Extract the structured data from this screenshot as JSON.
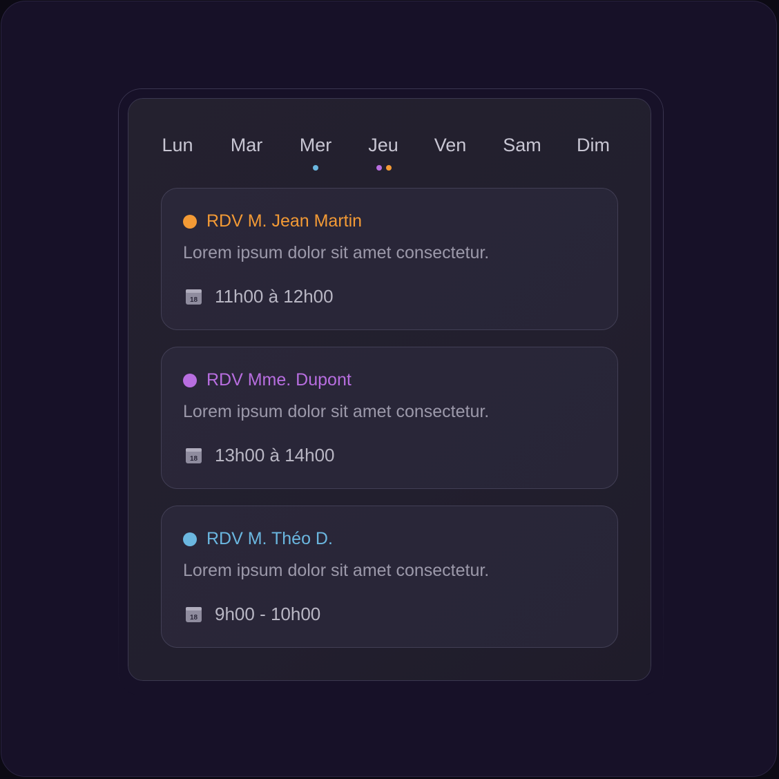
{
  "days": [
    {
      "label": "Lun",
      "dots": []
    },
    {
      "label": "Mar",
      "dots": []
    },
    {
      "label": "Mer",
      "dots": [
        "#6bb7e0"
      ]
    },
    {
      "label": "Jeu",
      "dots": [
        "#b86ee0",
        "#f39a35"
      ]
    },
    {
      "label": "Ven",
      "dots": []
    },
    {
      "label": "Sam",
      "dots": []
    },
    {
      "label": "Dim",
      "dots": []
    }
  ],
  "appointments": [
    {
      "title": "RDV M. Jean Martin",
      "description": "Lorem ipsum dolor sit amet consectetur.",
      "time": "11h00 à 12h00",
      "color": "#f39a35",
      "icon": "calendar-icon",
      "icon_day": "18"
    },
    {
      "title": "RDV Mme. Dupont",
      "description": "Lorem ipsum dolor sit amet consectetur.",
      "time": "13h00 à 14h00",
      "color": "#b86ee0",
      "icon": "calendar-icon",
      "icon_day": "18"
    },
    {
      "title": "RDV M. Théo D.",
      "description": "Lorem ipsum dolor sit amet consectetur.",
      "time": "9h00 - 10h00",
      "color": "#6bb7e0",
      "icon": "calendar-icon",
      "icon_day": "18"
    }
  ],
  "colors": {
    "background": "#171128",
    "panel": "#24212f",
    "card": "#2a2739",
    "day_text": "#c8c6d3",
    "description_text": "#9c99aa"
  }
}
